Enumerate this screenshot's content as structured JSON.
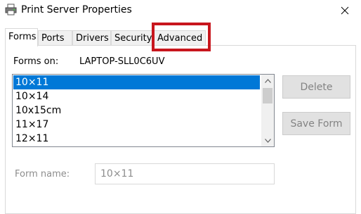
{
  "window": {
    "title": "Print Server Properties",
    "icon": "printer-icon",
    "close_icon": "close-icon"
  },
  "tabs": [
    {
      "label": "Forms",
      "selected": true
    },
    {
      "label": "Ports",
      "selected": false
    },
    {
      "label": "Drivers",
      "selected": false
    },
    {
      "label": "Security",
      "selected": false
    },
    {
      "label": "Advanced",
      "selected": false,
      "highlighted": true
    }
  ],
  "forms": {
    "forms_on_label": "Forms on:",
    "server_name": "LAPTOP-SLL0C6UV",
    "list_items": [
      "10×11",
      "10×14",
      "10x15cm",
      "11×17",
      "12×11"
    ],
    "selected_item": "10×11",
    "delete_label": "Delete",
    "save_form_label": "Save Form",
    "form_name_label": "Form name:",
    "form_name_value": "10×11"
  },
  "colors": {
    "selection": "#0078d7",
    "highlight_box": "#c8161d",
    "disabled_text": "#838383"
  }
}
